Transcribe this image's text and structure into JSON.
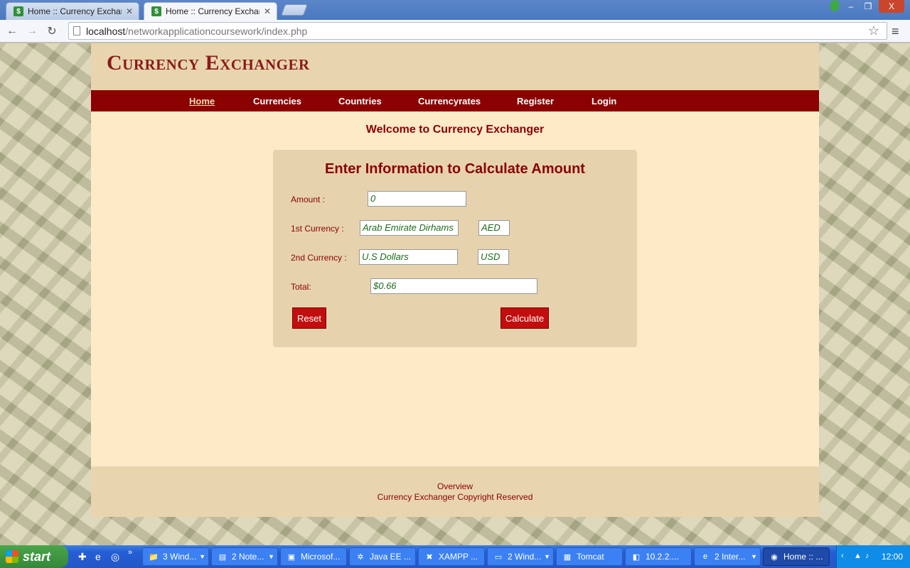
{
  "browser": {
    "tabs": [
      {
        "title": "Home :: Currency Exchanger",
        "favicon": "$",
        "active": false
      },
      {
        "title": "Home :: Currency Exchanger",
        "favicon": "$",
        "active": true
      }
    ],
    "url_host": "localhost",
    "url_path": "/networkapplicationcoursework/index.php",
    "window_controls": {
      "minimize": "–",
      "restore": "❐",
      "close": "X"
    }
  },
  "site": {
    "title": "Currency Exchanger",
    "nav": [
      "Home",
      "Currencies",
      "Countries",
      "Currencyrates",
      "Register",
      "Login"
    ],
    "welcome": "Welcome to Currency Exchanger",
    "form": {
      "heading": "Enter Information to Calculate Amount",
      "amount_label": "Amount :",
      "amount_value": "0",
      "first_label": "1st Currency :",
      "first_currency": "Arab Emirate Dirhams",
      "first_code": "AED",
      "second_label": "2nd Currency :",
      "second_currency": "U.S Dollars",
      "second_code": "USD",
      "total_label": "Total:",
      "total_value": "$0.66",
      "reset_label": "Reset",
      "calculate_label": "Calculate"
    },
    "footer": {
      "overview": "Overview",
      "copyright": "Currency Exchanger Copyright Reserved"
    },
    "colors": {
      "accent": "#8b0000",
      "background": "#fdebc7"
    }
  },
  "taskbar": {
    "start": "start",
    "tasks": [
      "3 Wind...",
      "2 Note...",
      "Microsof...",
      "Java EE ...",
      "XAMPP ...",
      "2 Wind...",
      "Tomcat",
      "10.2.2....",
      "2 Inter...",
      "Home :: ..."
    ],
    "clock": "12:00"
  }
}
